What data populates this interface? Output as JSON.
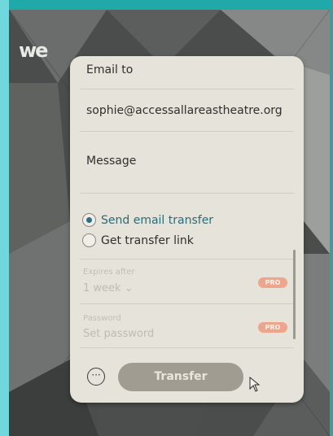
{
  "app": {
    "logo": "we"
  },
  "transfer_form": {
    "email_to_label": "Email to",
    "recipient_email": "sophie@accessallareastheatre.org",
    "message_placeholder": "Message",
    "options": {
      "send_email_transfer": {
        "label": "Send email transfer",
        "selected": true
      },
      "get_transfer_link": {
        "label": "Get transfer link",
        "selected": false
      }
    },
    "expires": {
      "label": "Expires after",
      "value": "1 week",
      "chevron": "chevron-down-icon",
      "badge": "PRO"
    },
    "password": {
      "label": "Password",
      "placeholder": "Set password",
      "badge": "PRO"
    },
    "more_icon": "ellipsis-icon",
    "transfer_button": "Transfer"
  },
  "colors": {
    "accent": "#2d6f85",
    "pro_badge": "#efa58c",
    "transfer_button_bg": "#a09c92",
    "frame_teal": "#1fa9a9"
  }
}
